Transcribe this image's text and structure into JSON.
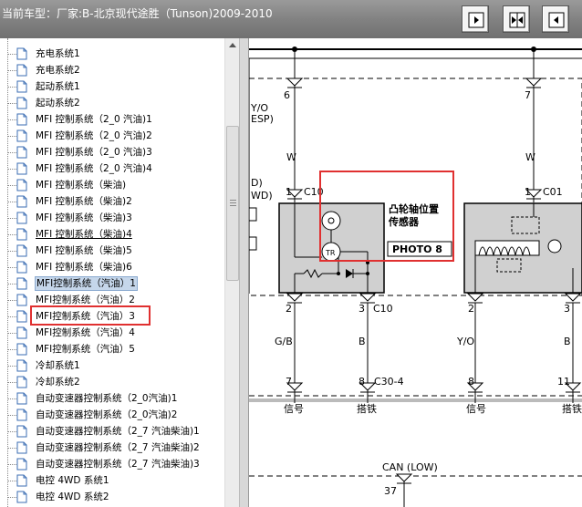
{
  "window": {
    "title": "当前车型：厂家:B-北京现代途胜（Tunson)2009-2010"
  },
  "toolbar": {
    "buttons": [
      "show-left-icon",
      "split-icon",
      "show-right-icon"
    ]
  },
  "tree": {
    "items": [
      {
        "label": "充电系统1"
      },
      {
        "label": "充电系统2"
      },
      {
        "label": "起动系统1"
      },
      {
        "label": "起动系统2"
      },
      {
        "label": "MFI 控制系统（2_0 汽油)1"
      },
      {
        "label": "MFI 控制系统（2_0 汽油)2"
      },
      {
        "label": "MFI 控制系统（2_0 汽油)3"
      },
      {
        "label": "MFI 控制系统（2_0 汽油)4"
      },
      {
        "label": "MFI 控制系统（柴油)"
      },
      {
        "label": "MFI 控制系统（柴油)2"
      },
      {
        "label": "MFI 控制系统（柴油)3"
      },
      {
        "label": "MFI 控制系统（柴油)4"
      },
      {
        "label": "MFI 控制系统（柴油)5"
      },
      {
        "label": "MFI 控制系统（柴油)6"
      },
      {
        "label": "MFI控制系统（汽油）1"
      },
      {
        "label": "MFI控制系统（汽油）2"
      },
      {
        "label": "MFI控制系统（汽油）3"
      },
      {
        "label": "MFI控制系统（汽油）4"
      },
      {
        "label": "MFI控制系统（汽油）5"
      },
      {
        "label": "冷却系统1"
      },
      {
        "label": "冷却系统2"
      },
      {
        "label": "自动变速器控制系统（2_0汽油)1"
      },
      {
        "label": "自动变速器控制系统（2_0汽油)2"
      },
      {
        "label": "自动变速器控制系统（2_7 汽油柴油)1"
      },
      {
        "label": "自动变速器控制系统（2_7 汽油柴油)2"
      },
      {
        "label": "自动变速器控制系统（2_7 汽油柴油)3"
      },
      {
        "label": "电控 4WD 系统1"
      },
      {
        "label": "电控 4WD 系统2"
      }
    ]
  },
  "diagram": {
    "pin_top_left": "6",
    "pin_top_right": "7",
    "left_partial_1": "Y/O",
    "left_partial_2": "ESP)",
    "left_partial_3": "D)",
    "left_partial_4": "WD)",
    "wire_w_left": "W",
    "wire_w_right": "W",
    "conn_left_pin": "1",
    "conn_left_name": "C10",
    "conn_right_pin": "1",
    "conn_right_name": "C01",
    "sensor_name_line1": "凸轮轴位置",
    "sensor_name_line2": "传感器",
    "photo_label": "PHOTO 8",
    "tr_label": "TR",
    "pin2_left": "2",
    "pin3_left": "3",
    "pin3_left_conn": "C10",
    "pin2_right": "2",
    "pin3_right": "3",
    "wire_gb": "G/B",
    "wire_b_left": "B",
    "wire_yo": "Y/O",
    "wire_b_right": "B",
    "pin7": "7",
    "pin8_left": "8",
    "conn_c30": "C30-4",
    "pin8_right": "8",
    "pin11": "11",
    "signal_left": "信号",
    "ground_left": "搭铁",
    "signal_right": "信号",
    "ground_right": "搭铁",
    "can_low": "CAN (LOW)",
    "pin37": "37"
  }
}
